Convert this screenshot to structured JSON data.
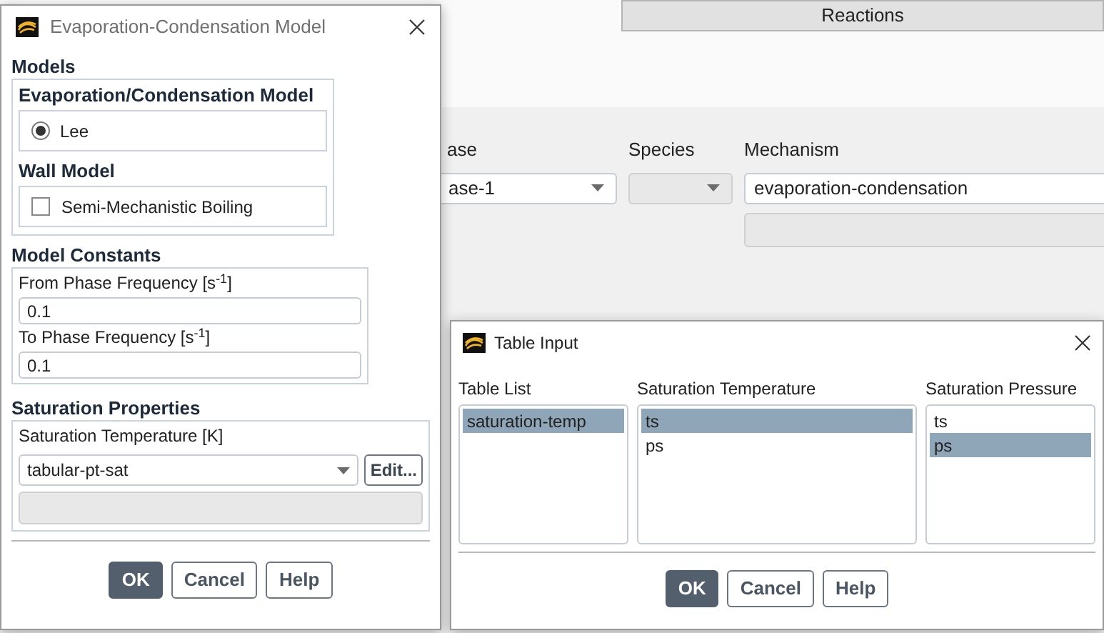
{
  "background_window": {
    "tabs": [
      {
        "label": "Reactions",
        "selected": false
      }
    ],
    "phase": {
      "label": "ase",
      "value": "ase-1"
    },
    "species": {
      "label": "Species",
      "disabled": true
    },
    "mechanism": {
      "label": "Mechanism",
      "value": "evaporation-condensation"
    }
  },
  "evaporation_dialog": {
    "title": "Evaporation-Condensation Model",
    "heading": "Models",
    "evaporation_model": {
      "heading": "Evaporation/Condensation Model",
      "options": [
        {
          "label": "Lee",
          "selected": true
        }
      ]
    },
    "wall_model": {
      "heading": "Wall Model",
      "options": [
        {
          "label": "Semi-Mechanistic Boiling",
          "checked": false
        }
      ]
    },
    "model_constants": {
      "heading": "Model Constants",
      "fields": [
        {
          "label": "From Phase Frequency [s$^{-1}$]",
          "value": "0.1"
        },
        {
          "label": "To Phase Frequency [s$^{-1}$]",
          "value": "0.1"
        }
      ]
    },
    "saturation_properties": {
      "heading": "Saturation Properties",
      "label": "Saturation Temperature [K]",
      "value": "tabular-pt-sat",
      "edit_button": "Edit..."
    },
    "buttons": [
      {
        "label": "OK",
        "default": true
      },
      {
        "label": "Cancel",
        "default": false
      },
      {
        "label": "Help",
        "default": false
      }
    ]
  },
  "table_input_dialog": {
    "title": "Table Input",
    "lists": [
      {
        "heading": "Table List",
        "items": [
          {
            "label": "saturation-temp",
            "selected": true
          }
        ]
      },
      {
        "heading": "Saturation Temperature",
        "items": [
          {
            "label": "ts",
            "selected": true
          },
          {
            "label": "ps",
            "selected": false
          }
        ]
      },
      {
        "heading": "Saturation Pressure",
        "items": [
          {
            "label": "ts",
            "selected": false
          },
          {
            "label": "ps",
            "selected": true
          }
        ]
      }
    ],
    "buttons": [
      {
        "label": "OK",
        "default": true
      },
      {
        "label": "Cancel",
        "default": false
      },
      {
        "label": "Help",
        "default": false
      }
    ]
  }
}
